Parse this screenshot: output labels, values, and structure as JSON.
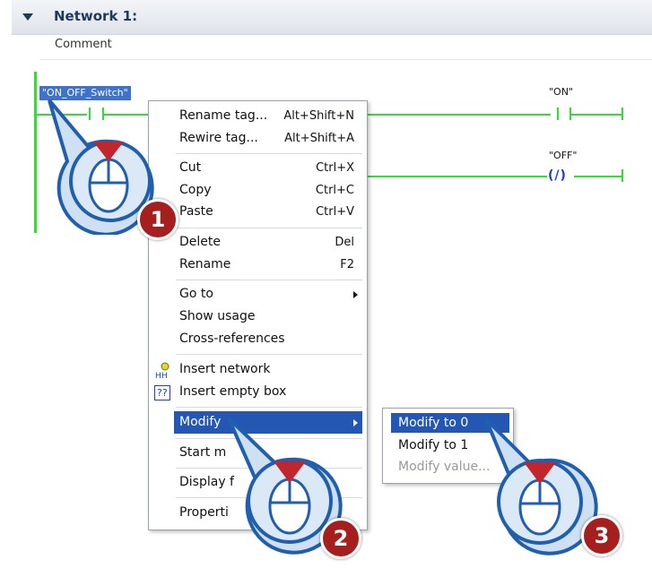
{
  "network": {
    "title": "Network 1:",
    "comment": "Comment"
  },
  "ladder": {
    "selected_tag": "\"ON_OFF_Switch\"",
    "coil_on": "\"ON\"",
    "coil_off": "\"OFF\"",
    "nc_contact_glyph": "(/)"
  },
  "context_menu": {
    "rename_tag": "Rename tag...",
    "rename_tag_sc": "Alt+Shift+N",
    "rewire_tag": "Rewire tag...",
    "rewire_tag_sc": "Alt+Shift+A",
    "cut": "Cut",
    "cut_sc": "Ctrl+X",
    "copy": "Copy",
    "copy_sc": "Ctrl+C",
    "paste": "Paste",
    "paste_sc": "Ctrl+V",
    "delete": "Delete",
    "delete_sc": "Del",
    "rename": "Rename",
    "rename_sc": "F2",
    "go_to": "Go to",
    "show_usage": "Show usage",
    "cross_references": "Cross-references",
    "insert_network": "Insert network",
    "insert_empty_box": "Insert empty box",
    "empty_box_glyph": "??",
    "modify": "Modify",
    "start_modify": "Start m",
    "display_format": "Display f",
    "properties": "Properti"
  },
  "submenu": {
    "modify_to_0": "Modify to 0",
    "modify_to_1": "Modify to 1",
    "modify_value": "Modify value..."
  },
  "steps": {
    "one": "1",
    "two": "2",
    "three": "3"
  },
  "colors": {
    "accent": "#2456b4",
    "wire": "#33dd33",
    "badge": "#a51f1f",
    "cursor_circle": "#1f5fae"
  }
}
